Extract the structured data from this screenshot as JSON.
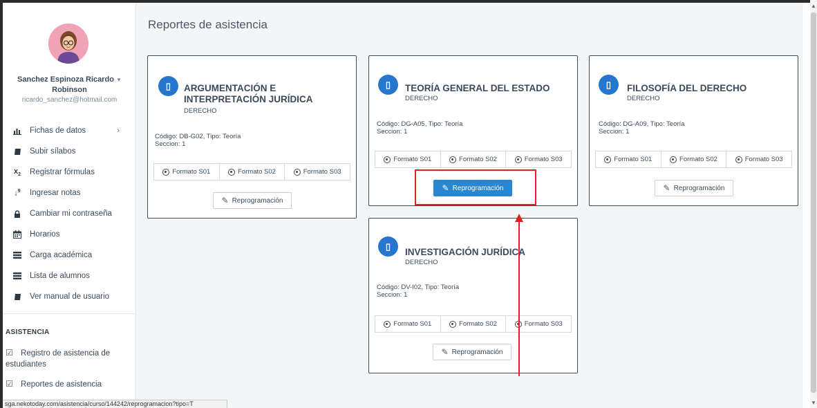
{
  "user": {
    "name_line1": "Sanchez Espinoza Ricardo",
    "name_line2": "Robinson",
    "email": "ricardo_sanchez@hotmail.com"
  },
  "menu": [
    {
      "label": "Fichas de datos",
      "icon": "bar-chart-icon"
    },
    {
      "label": "Subir sílabos",
      "icon": "book-icon"
    },
    {
      "label": "Registrar fórmulas",
      "icon": "subscript-icon"
    },
    {
      "label": "Ingresar notas",
      "icon": "sort-numeric-icon"
    },
    {
      "label": "Cambiar mi contraseña",
      "icon": "lock-icon"
    },
    {
      "label": "Horarios",
      "icon": "calendar-icon"
    },
    {
      "label": "Carga académica",
      "icon": "list-icon"
    },
    {
      "label": "Lista de alumnos",
      "icon": "list-icon"
    },
    {
      "label": "Ver manual de usuario",
      "icon": "book-icon"
    }
  ],
  "asistencia": {
    "title": "ASISTENCIA",
    "items": [
      {
        "label": "Registro de asistencia de estudiantes",
        "icon": "checkbox-icon"
      },
      {
        "label": "Reportes de asistencia",
        "icon": "checkbox-icon"
      }
    ]
  },
  "page": {
    "title": "Reportes de asistencia"
  },
  "courses": [
    {
      "title_line1": "ARGUMENTACIÓN E",
      "title_line2": "INTERPRETACIÓN JURÍDICA",
      "subtitle": "DERECHO",
      "code_line": "Código: DB-G02, Tipo: Teoría",
      "section_line": "Seccion: 1",
      "formats": [
        "Formato S01",
        "Formato S02",
        "Formato S03"
      ],
      "reprog": "Reprogramación"
    },
    {
      "title_line1": "TEORÍA GENERAL DEL ESTADO",
      "title_line2": "",
      "subtitle": "DERECHO",
      "code_line": "Código: DG-A05, Tipo: Teoría",
      "section_line": "Seccion: 1",
      "formats": [
        "Formato S01",
        "Formato S02",
        "Formato S03"
      ],
      "reprog": "Reprogramación"
    },
    {
      "title_line1": "FILOSOFÍA DEL DERECHO",
      "title_line2": "",
      "subtitle": "DERECHO",
      "code_line": "Código: DG-A09, Tipo: Teoría",
      "section_line": "Seccion: 1",
      "formats": [
        "Formato S01",
        "Formato S02",
        "Formato S03"
      ],
      "reprog": "Reprogramación"
    },
    {
      "title_line1": "INVESTIGACIÓN JURÍDICA",
      "title_line2": "",
      "subtitle": "DERECHO",
      "code_line": "Código: DV-I02, Tipo: Teoría",
      "section_line": "Seccion: 1",
      "formats": [
        "Formato S01",
        "Formato S02",
        "Formato S03"
      ],
      "reprog": "Reprogramación"
    }
  ],
  "status_url": "sga.nekotoday.com/asistencia/curso/144242/reprogramacion?tipo=T",
  "colors": {
    "accent": "#2576cc",
    "button_active": "#2a86cf",
    "annotation": "#e02020"
  }
}
